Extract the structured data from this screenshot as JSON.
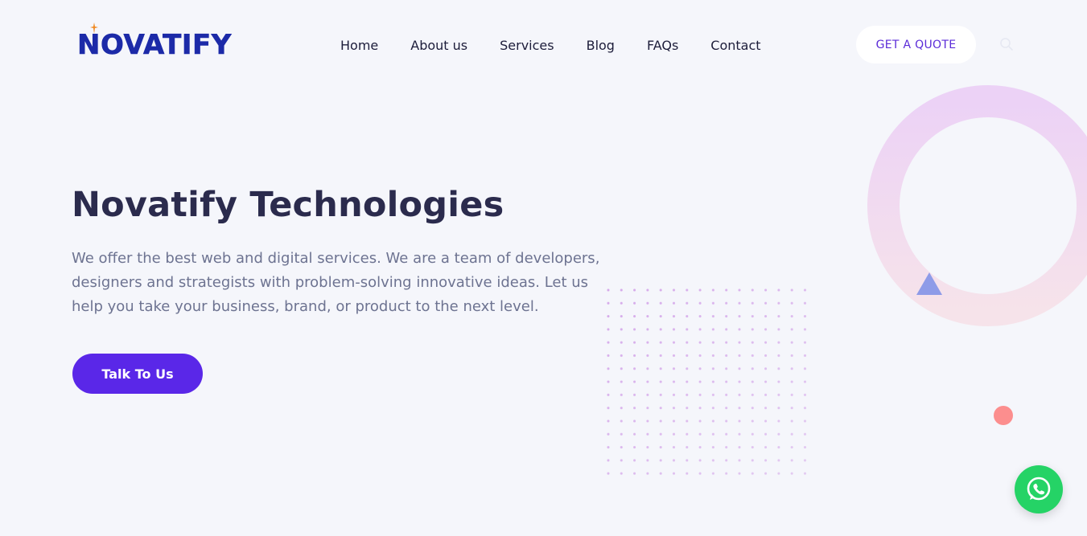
{
  "brand": {
    "logo_text": "NOVATIFY",
    "logo_color": "#1c2aa8"
  },
  "nav": {
    "items": [
      {
        "label": "Home"
      },
      {
        "label": "About us"
      },
      {
        "label": "Services"
      },
      {
        "label": "Blog"
      },
      {
        "label": "FAQs"
      },
      {
        "label": "Contact"
      }
    ]
  },
  "header": {
    "quote_label": "GET A QUOTE",
    "search_icon": "search-icon"
  },
  "hero": {
    "title": "Novatify Technologies",
    "description": "We offer the best web and digital services. We are a team of developers, designers and strategists with problem-solving innovative ideas. Let us help you take your business, brand, or product to the next level.",
    "cta_label": "Talk To Us"
  },
  "colors": {
    "accent": "#5a27e8",
    "background": "#f5f6fb",
    "whatsapp": "#25d366",
    "coral": "#fc8e8e",
    "triangle": "#8e9be8"
  },
  "floating": {
    "whatsapp_icon": "whatsapp-icon"
  }
}
